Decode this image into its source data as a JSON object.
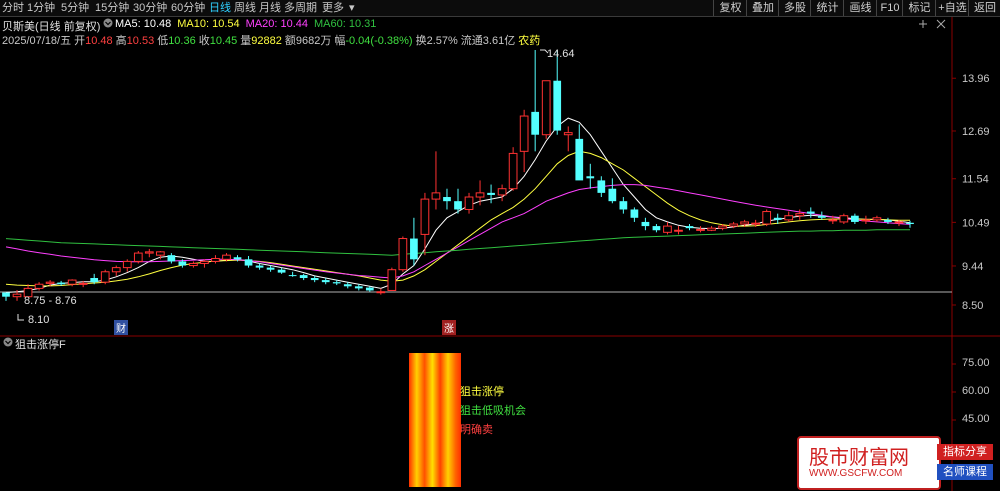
{
  "colors": {
    "up": "#ff3232",
    "down": "#54ffff",
    "ma5": "#ffffff",
    "ma10": "#ffff40",
    "ma20": "#ff40ff",
    "ma60": "#30c040",
    "grid": "#7a0000",
    "axis": "#c8c8c8",
    "label": "#c8c8c8"
  },
  "toolbar": {
    "periods": [
      "分时",
      "1分钟",
      "5分钟",
      "15分钟",
      "30分钟",
      "60分钟",
      "日线",
      "周线",
      "月线",
      "多周期",
      "更多"
    ],
    "active_period": "日线",
    "right_buttons": [
      "复权",
      "叠加",
      "多股",
      "统计",
      "画线",
      "F10",
      "标记",
      "+自选",
      "返回"
    ]
  },
  "stock": {
    "name": "贝斯美",
    "adjust": "(日线 前复权)"
  },
  "ma": [
    {
      "label": "MA5:",
      "value": "10.48",
      "color": "#ffffff"
    },
    {
      "label": "MA10:",
      "value": "10.54",
      "color": "#ffff40"
    },
    {
      "label": "MA20:",
      "value": "10.44",
      "color": "#ff40ff"
    },
    {
      "label": "MA60:",
      "value": "10.31",
      "color": "#30c040"
    }
  ],
  "quote": [
    {
      "label": "2025/07/18/五",
      "value": "",
      "color": "#c8c8c8"
    },
    {
      "label": "开",
      "value": "10.48",
      "color": "#ff4040"
    },
    {
      "label": "高",
      "value": "10.53",
      "color": "#ff4040"
    },
    {
      "label": "低",
      "value": "10.36",
      "color": "#40e040"
    },
    {
      "label": "收",
      "value": "10.45",
      "color": "#40e040"
    },
    {
      "label": "量",
      "value": "92882",
      "color": "#ffff40"
    },
    {
      "label": "额",
      "value": "9682万",
      "color": "#c8c8c8"
    },
    {
      "label": "幅",
      "value": "-0.04(-0.38%)",
      "color": "#40e040"
    },
    {
      "label": "换",
      "value": "2.57%",
      "color": "#c8c8c8"
    },
    {
      "label": "流通",
      "value": "3.61亿",
      "color": "#c8c8c8"
    },
    {
      "label": "",
      "value": "农药",
      "color": "#ffff40"
    }
  ],
  "annotations": {
    "high": "14.64",
    "low": "8.10",
    "range": "8.75 - 8.76",
    "badge_fin": "财",
    "badge_zt": "涨"
  },
  "indicator": {
    "title": "狙击涨停F",
    "axis": [
      "75.00",
      "60.00",
      "45.00"
    ],
    "signals": [
      {
        "text": "狙击涨停",
        "color": "#ffff40"
      },
      {
        "text": "狙击低吸机会",
        "color": "#40e040"
      },
      {
        "text": "明确卖",
        "color": "#ff4040"
      }
    ]
  },
  "watermark": {
    "title": "股市财富网",
    "url": "WWW.GSCFW.COM",
    "tag1": "指标分享",
    "tag2": "名师课程"
  },
  "chart_data": {
    "type": "candlestick",
    "ylim": [
      8.5,
      14.64
    ],
    "yticks": [
      13.96,
      12.69,
      11.54,
      10.49,
      9.44,
      8.5
    ],
    "candles": [
      [
        8.8,
        8.8,
        8.6,
        8.7
      ],
      [
        8.7,
        8.86,
        8.6,
        8.76
      ],
      [
        8.7,
        9.0,
        8.7,
        8.9
      ],
      [
        8.9,
        9.05,
        8.85,
        9.0
      ],
      [
        9.02,
        9.1,
        8.95,
        9.05
      ],
      [
        9.04,
        9.08,
        8.96,
        9.0
      ],
      [
        9.0,
        9.12,
        8.95,
        9.1
      ],
      [
        9.0,
        9.08,
        8.93,
        9.02
      ],
      [
        9.15,
        9.25,
        9.0,
        9.05
      ],
      [
        9.05,
        9.35,
        9.0,
        9.3
      ],
      [
        9.3,
        9.45,
        9.2,
        9.4
      ],
      [
        9.4,
        9.6,
        9.3,
        9.55
      ],
      [
        9.55,
        9.8,
        9.5,
        9.75
      ],
      [
        9.75,
        9.85,
        9.65,
        9.78
      ],
      [
        9.7,
        9.8,
        9.6,
        9.78
      ],
      [
        9.7,
        9.75,
        9.5,
        9.55
      ],
      [
        9.55,
        9.6,
        9.4,
        9.45
      ],
      [
        9.45,
        9.55,
        9.4,
        9.5
      ],
      [
        9.5,
        9.6,
        9.4,
        9.55
      ],
      [
        9.55,
        9.7,
        9.5,
        9.62
      ],
      [
        9.6,
        9.75,
        9.55,
        9.7
      ],
      [
        9.65,
        9.7,
        9.55,
        9.6
      ],
      [
        9.6,
        9.68,
        9.4,
        9.45
      ],
      [
        9.45,
        9.5,
        9.35,
        9.4
      ],
      [
        9.4,
        9.45,
        9.3,
        9.35
      ],
      [
        9.35,
        9.4,
        9.25,
        9.28
      ],
      [
        9.22,
        9.3,
        9.18,
        9.2
      ],
      [
        9.22,
        9.25,
        9.1,
        9.15
      ],
      [
        9.15,
        9.2,
        9.05,
        9.1
      ],
      [
        9.1,
        9.15,
        9.0,
        9.05
      ],
      [
        9.05,
        9.1,
        8.98,
        9.02
      ],
      [
        9.0,
        9.05,
        8.9,
        8.95
      ],
      [
        8.95,
        9.0,
        8.85,
        8.9
      ],
      [
        8.92,
        8.95,
        8.82,
        8.85
      ],
      [
        8.8,
        8.9,
        8.75,
        8.82
      ],
      [
        8.85,
        9.4,
        8.85,
        9.35
      ],
      [
        9.35,
        10.15,
        9.3,
        10.1
      ],
      [
        10.1,
        10.6,
        9.45,
        9.6
      ],
      [
        10.2,
        11.2,
        9.7,
        11.05
      ],
      [
        11.05,
        12.2,
        10.8,
        11.2
      ],
      [
        11.1,
        11.3,
        10.8,
        11.0
      ],
      [
        11.0,
        11.3,
        10.7,
        10.8
      ],
      [
        10.8,
        11.2,
        10.7,
        11.1
      ],
      [
        11.1,
        11.5,
        10.9,
        11.2
      ],
      [
        11.2,
        11.4,
        10.95,
        11.15
      ],
      [
        11.15,
        11.4,
        11.0,
        11.3
      ],
      [
        11.3,
        12.3,
        11.25,
        12.15
      ],
      [
        12.2,
        13.2,
        11.7,
        13.05
      ],
      [
        13.15,
        14.64,
        12.2,
        12.6
      ],
      [
        12.6,
        13.9,
        12.5,
        13.9
      ],
      [
        13.9,
        14.64,
        12.6,
        12.7
      ],
      [
        12.6,
        12.8,
        12.2,
        12.65
      ],
      [
        12.5,
        12.85,
        11.6,
        11.5
      ],
      [
        11.6,
        11.9,
        11.3,
        11.55
      ],
      [
        11.5,
        11.6,
        11.1,
        11.2
      ],
      [
        11.3,
        11.55,
        10.95,
        11.0
      ],
      [
        11.0,
        11.1,
        10.7,
        10.8
      ],
      [
        10.8,
        10.85,
        10.5,
        10.6
      ],
      [
        10.5,
        10.6,
        10.3,
        10.4
      ],
      [
        10.4,
        10.45,
        10.25,
        10.3
      ],
      [
        10.25,
        10.5,
        10.2,
        10.4
      ],
      [
        10.3,
        10.4,
        10.2,
        10.3
      ],
      [
        10.4,
        10.45,
        10.3,
        10.35
      ],
      [
        10.3,
        10.4,
        10.25,
        10.32
      ],
      [
        10.3,
        10.4,
        10.28,
        10.35
      ],
      [
        10.35,
        10.45,
        10.3,
        10.4
      ],
      [
        10.4,
        10.5,
        10.35,
        10.45
      ],
      [
        10.45,
        10.55,
        10.38,
        10.5
      ],
      [
        10.45,
        10.55,
        10.38,
        10.47
      ],
      [
        10.45,
        10.8,
        10.4,
        10.75
      ],
      [
        10.6,
        10.7,
        10.45,
        10.55
      ],
      [
        10.55,
        10.75,
        10.5,
        10.65
      ],
      [
        10.65,
        10.8,
        10.55,
        10.7
      ],
      [
        10.75,
        10.85,
        10.6,
        10.7
      ],
      [
        10.65,
        10.75,
        10.55,
        10.6
      ],
      [
        10.55,
        10.65,
        10.45,
        10.55
      ],
      [
        10.5,
        10.7,
        10.45,
        10.65
      ],
      [
        10.65,
        10.7,
        10.45,
        10.5
      ],
      [
        10.55,
        10.65,
        10.45,
        10.55
      ],
      [
        10.55,
        10.65,
        10.5,
        10.6
      ],
      [
        10.55,
        10.6,
        10.45,
        10.5
      ],
      [
        10.48,
        10.55,
        10.4,
        10.5
      ],
      [
        10.48,
        10.53,
        10.36,
        10.45
      ]
    ],
    "ma": [
      {
        "name": "MA5",
        "color": "#ffffff",
        "values": [
          8.8,
          8.82,
          8.85,
          8.9,
          8.98,
          9.02,
          9.04,
          9.06,
          9.06,
          9.1,
          9.18,
          9.28,
          9.4,
          9.55,
          9.65,
          9.68,
          9.65,
          9.6,
          9.55,
          9.55,
          9.58,
          9.6,
          9.56,
          9.5,
          9.45,
          9.4,
          9.35,
          9.28,
          9.2,
          9.15,
          9.1,
          9.05,
          9.0,
          8.95,
          8.9,
          9.0,
          9.25,
          9.45,
          9.85,
          10.3,
          10.6,
          10.75,
          10.9,
          11.0,
          11.05,
          11.1,
          11.3,
          11.6,
          12.0,
          12.45,
          12.8,
          13.0,
          12.9,
          12.6,
          12.2,
          11.8,
          11.4,
          11.1,
          10.8,
          10.6,
          10.5,
          10.42,
          10.37,
          10.35,
          10.34,
          10.35,
          10.38,
          10.42,
          10.45,
          10.52,
          10.56,
          10.6,
          10.64,
          10.66,
          10.64,
          10.62,
          10.6,
          10.58,
          10.56,
          10.56,
          10.55,
          10.52,
          10.48
        ]
      },
      {
        "name": "MA10",
        "color": "#ffff40",
        "values": [
          9.0,
          8.98,
          8.97,
          8.96,
          8.96,
          8.97,
          8.99,
          9.01,
          9.03,
          9.05,
          9.08,
          9.12,
          9.18,
          9.25,
          9.33,
          9.4,
          9.46,
          9.5,
          9.53,
          9.56,
          9.57,
          9.58,
          9.57,
          9.55,
          9.52,
          9.48,
          9.44,
          9.4,
          9.36,
          9.32,
          9.28,
          9.24,
          9.2,
          9.15,
          9.1,
          9.07,
          9.1,
          9.2,
          9.35,
          9.55,
          9.75,
          9.95,
          10.15,
          10.35,
          10.55,
          10.7,
          10.85,
          11.05,
          11.3,
          11.6,
          11.9,
          12.1,
          12.2,
          12.15,
          12.05,
          11.9,
          11.75,
          11.55,
          11.35,
          11.15,
          10.95,
          10.78,
          10.65,
          10.55,
          10.48,
          10.43,
          10.4,
          10.4,
          10.41,
          10.44,
          10.47,
          10.5,
          10.53,
          10.55,
          10.56,
          10.57,
          10.57,
          10.57,
          10.56,
          10.56,
          10.55,
          10.54,
          10.54
        ]
      },
      {
        "name": "MA20",
        "color": "#ff40ff",
        "values": [
          9.9,
          9.85,
          9.8,
          9.76,
          9.72,
          9.68,
          9.65,
          9.62,
          9.59,
          9.57,
          9.55,
          9.54,
          9.54,
          9.54,
          9.55,
          9.56,
          9.57,
          9.58,
          9.59,
          9.6,
          9.6,
          9.59,
          9.57,
          9.54,
          9.5,
          9.46,
          9.42,
          9.38,
          9.34,
          9.3,
          9.27,
          9.24,
          9.21,
          9.19,
          9.17,
          9.15,
          9.2,
          9.3,
          9.45,
          9.6,
          9.75,
          9.9,
          10.05,
          10.2,
          10.35,
          10.5,
          10.6,
          10.7,
          10.85,
          11.0,
          11.1,
          11.2,
          11.28,
          11.32,
          11.35,
          11.38,
          11.4,
          11.4,
          11.38,
          11.34,
          11.3,
          11.25,
          11.2,
          11.15,
          11.1,
          11.05,
          11.0,
          10.95,
          10.9,
          10.86,
          10.82,
          10.78,
          10.74,
          10.7,
          10.66,
          10.62,
          10.58,
          10.55,
          10.52,
          10.5,
          10.48,
          10.46,
          10.44
        ]
      },
      {
        "name": "MA60",
        "color": "#30c040",
        "values": [
          10.1,
          10.08,
          10.06,
          10.04,
          10.02,
          10.0,
          9.99,
          9.98,
          9.97,
          9.96,
          9.95,
          9.94,
          9.93,
          9.92,
          9.91,
          9.9,
          9.89,
          9.88,
          9.87,
          9.86,
          9.85,
          9.84,
          9.83,
          9.82,
          9.81,
          9.8,
          9.79,
          9.78,
          9.77,
          9.76,
          9.75,
          9.74,
          9.73,
          9.72,
          9.71,
          9.7,
          9.72,
          9.74,
          9.76,
          9.78,
          9.8,
          9.82,
          9.84,
          9.86,
          9.88,
          9.9,
          9.92,
          9.94,
          9.96,
          9.98,
          10.0,
          10.02,
          10.04,
          10.06,
          10.08,
          10.1,
          10.12,
          10.13,
          10.14,
          10.15,
          10.16,
          10.17,
          10.18,
          10.19,
          10.2,
          10.21,
          10.22,
          10.23,
          10.24,
          10.25,
          10.26,
          10.27,
          10.28,
          10.28,
          10.29,
          10.29,
          10.3,
          10.3,
          10.3,
          10.31,
          10.31,
          10.31,
          10.31
        ]
      }
    ]
  }
}
